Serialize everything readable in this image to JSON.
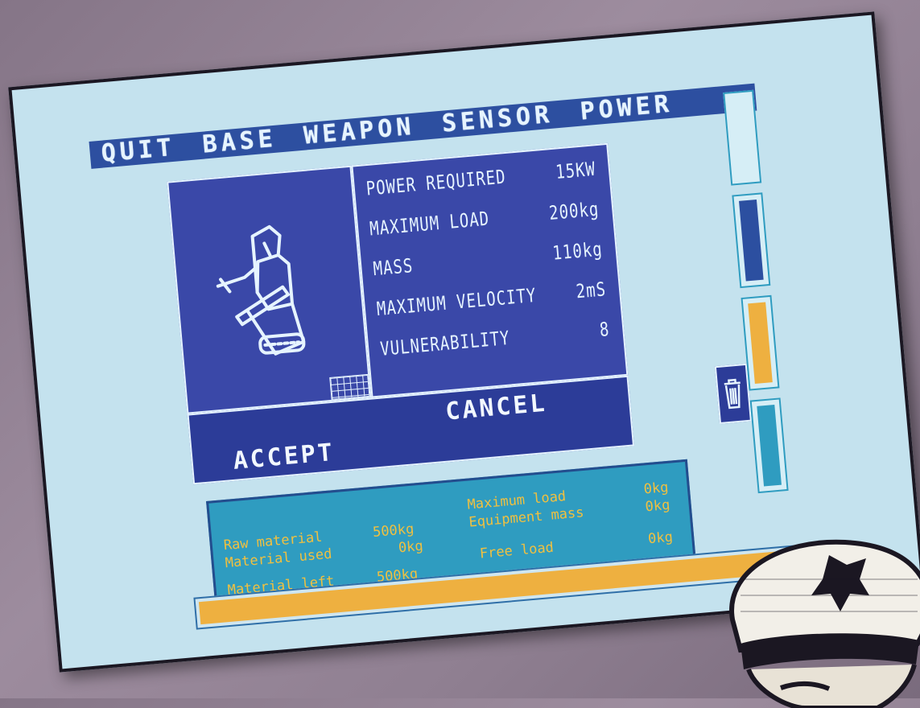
{
  "menu": {
    "items": [
      "QUIT",
      "BASE",
      "WEAPON",
      "SENSOR",
      "POWER"
    ]
  },
  "stats": [
    {
      "label": "POWER REQUIRED",
      "value": "15KW"
    },
    {
      "label": "MAXIMUM LOAD",
      "value": "200kg"
    },
    {
      "label": "MASS",
      "value": "110kg"
    },
    {
      "label": "MAXIMUM VELOCITY",
      "value": "2mS"
    },
    {
      "label": "VULNERABILITY",
      "value": "8"
    }
  ],
  "actions": {
    "accept_label": "ACCEPT",
    "cancel_label": "CANCEL"
  },
  "materials": {
    "raw_material_label": "Raw material",
    "raw_material_value": "500kg",
    "material_used_label": "Material used",
    "material_used_value": "0kg",
    "material_left_label": "Material left",
    "material_left_value": "500kg",
    "maximum_load_label": "Maximum load",
    "maximum_load_value": "0kg",
    "equipment_mass_label": "Equipment mass",
    "equipment_mass_value": "0kg",
    "free_load_label": "Free load",
    "free_load_value": "0kg"
  },
  "progress_fraction": 0.98,
  "side_slots": [
    {
      "name": "slot-empty",
      "color": "#d6eef6"
    },
    {
      "name": "slot-blue",
      "color": "#2c4fa0"
    },
    {
      "name": "slot-orange",
      "color": "#eeb040"
    },
    {
      "name": "slot-cyan",
      "color": "#2f9cc0"
    }
  ],
  "colors": {
    "screen_bg": "#c4e2ee",
    "panel_blue": "#3a48a8",
    "accent_orange": "#eeb040",
    "accent_cyan": "#2f9cc0"
  },
  "icons": [
    "robot-unit-icon",
    "grid-icon",
    "trash-icon",
    "captain-portrait"
  ]
}
